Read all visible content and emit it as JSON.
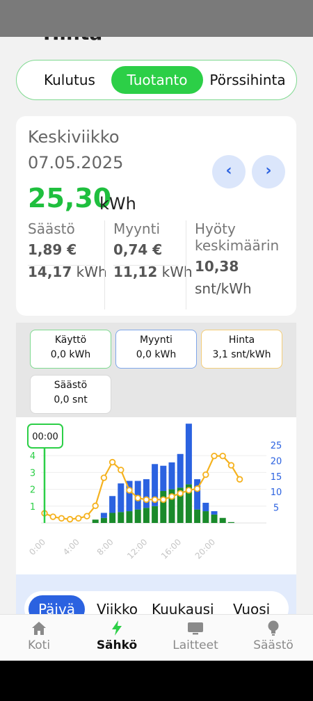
{
  "page": {
    "title_cut": "Hinta"
  },
  "tabs": {
    "items": [
      "Kulutus",
      "Tuotanto",
      "Pörssihinta"
    ],
    "active": "Tuotanto"
  },
  "summary": {
    "weekday": "Keskiviikko",
    "date": "07.05.2025",
    "prev_icon": "chevron-left-icon",
    "next_icon": "chevron-right-icon",
    "total_value": "25,30",
    "total_unit": "kWh",
    "saving_label": "Säästö",
    "saving_eur": "1,89 €",
    "saving_kwh_value": "14,17",
    "saving_kwh_unit": "kWh",
    "sales_label": "Myynti",
    "sales_eur": "0,74 €",
    "sales_kwh_value": "11,12",
    "sales_kwh_unit": "kWh",
    "benefit_label_1": "Hyöty",
    "benefit_label_2": "keskimäärin",
    "benefit_value": "10,38",
    "benefit_unit": "snt/kWh"
  },
  "stats": {
    "usage_title": "Käyttö",
    "usage_value": "0,0 kWh",
    "sales_title": "Myynti",
    "sales_value": "0,0 kWh",
    "price_title": "Hinta",
    "price_value": "3,1 snt/kWh",
    "saving_title": "Säästö",
    "saving_value": "0,0 snt"
  },
  "colors": {
    "accent_green": "#2ccf47",
    "bar_green": "#1a8a2b",
    "bar_blue": "#2b62e0",
    "line_orange": "#f5b21f"
  },
  "chart_data": {
    "type": "bar",
    "tooltip": "00:00",
    "x": [
      0,
      1,
      2,
      3,
      4,
      5,
      6,
      7,
      8,
      9,
      10,
      11,
      12,
      13,
      14,
      15,
      16,
      17,
      18,
      19,
      20,
      21,
      22,
      23
    ],
    "x_tick_labels": [
      "0:00",
      "4:00",
      "8:00",
      "12:00",
      "16:00",
      "20:00"
    ],
    "left_axis": {
      "ticks": [
        "1",
        "2",
        "3",
        "4"
      ],
      "ylim": [
        0,
        5
      ]
    },
    "right_axis": {
      "ticks": [
        "5",
        "10",
        "15",
        "20",
        "25"
      ],
      "ylim": [
        0,
        27
      ]
    },
    "series": [
      {
        "values": [
          0,
          0,
          0,
          0,
          0,
          0,
          0.2,
          0.3,
          0.6,
          0.65,
          0.7,
          0.8,
          0.9,
          1.0,
          1.9,
          2.0,
          2.1,
          2.3,
          0.8,
          0.7,
          0.5,
          0.3,
          0.05,
          0
        ]
      },
      {
        "values": [
          0,
          0,
          0,
          0,
          0,
          0,
          0,
          0.3,
          1.0,
          1.7,
          1.8,
          1.7,
          1.7,
          2.5,
          1.5,
          1.6,
          2.0,
          3.6,
          1.8,
          0.5,
          0.2,
          0,
          0,
          0
        ]
      },
      {
        "values": [
          3.1,
          2,
          1.5,
          1.2,
          1.5,
          2.2,
          5.5,
          14.5,
          19.5,
          17,
          10.5,
          8,
          7.5,
          7.5,
          7.5,
          8.5,
          9.5,
          10.5,
          11,
          15.5,
          21.5,
          21.5,
          18.5,
          14
        ]
      }
    ]
  },
  "period_tabs": {
    "items": [
      "Päivä",
      "Viikko",
      "Kuukausi",
      "Vuosi"
    ],
    "active": "Päivä"
  },
  "nav": {
    "items": [
      {
        "label": "Koti",
        "icon": "home-icon"
      },
      {
        "label": "Sähkö",
        "icon": "lightning-icon"
      },
      {
        "label": "Laitteet",
        "icon": "monitor-icon"
      },
      {
        "label": "Säästö",
        "icon": "lightbulb-icon"
      }
    ],
    "active": "Sähkö"
  }
}
